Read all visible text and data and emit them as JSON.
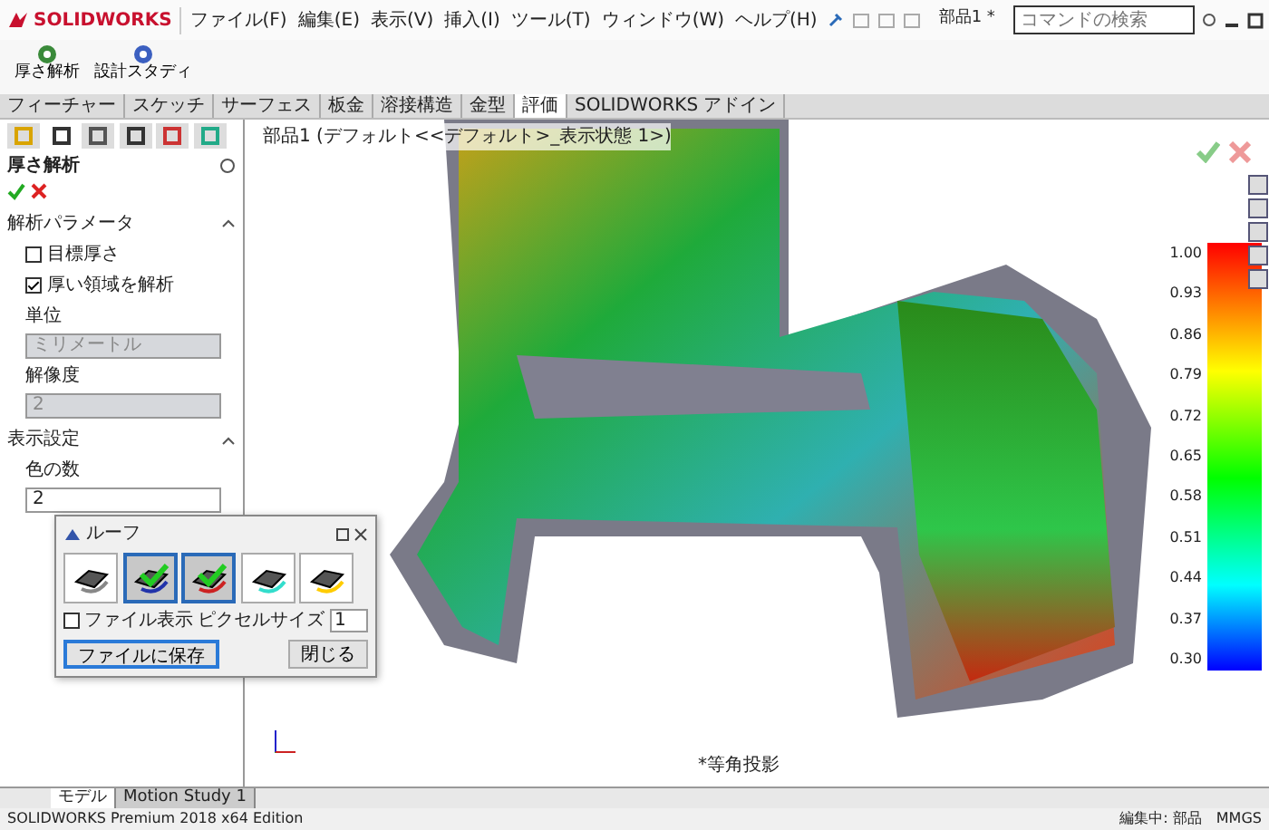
{
  "app": {
    "logo": "SOLIDWORKS",
    "menus": [
      "ファイル(F)",
      "編集(E)",
      "表示(V)",
      "挿入(I)",
      "ツール(T)",
      "ウィンドウ(W)",
      "ヘルプ(H)"
    ],
    "document_title": "部品1 *",
    "search": {
      "placeholder": "コマンドの検索"
    }
  },
  "ribbon": {
    "buttons": [
      {
        "label": "厚さ解析"
      },
      {
        "label": "設計スタディ"
      }
    ]
  },
  "command_tabs": [
    {
      "label": "フィーチャー",
      "selected": false
    },
    {
      "label": "スケッチ",
      "selected": false
    },
    {
      "label": "サーフェス",
      "selected": false
    },
    {
      "label": "板金",
      "selected": false
    },
    {
      "label": "溶接構造",
      "selected": false
    },
    {
      "label": "金型",
      "selected": false
    },
    {
      "label": "評価",
      "selected": true
    },
    {
      "label": "SOLIDWORKS アドイン",
      "selected": false
    }
  ],
  "panel_tabs": [
    {
      "selected": false
    },
    {
      "selected": true
    },
    {
      "selected": false
    },
    {
      "selected": false
    },
    {
      "selected": false
    },
    {
      "selected": false
    }
  ],
  "property_manager": {
    "title": "厚さ解析",
    "sections": [
      {
        "title": "解析パラメータ",
        "items": [
          {
            "kind": "checkbox",
            "label": "目標厚さ",
            "checked": false
          },
          {
            "kind": "checkbox",
            "label": "厚い領域を解析",
            "checked": true
          },
          {
            "kind": "label",
            "label": "単位"
          },
          {
            "kind": "spin",
            "value": "ミリメートル",
            "disabled": true
          },
          {
            "kind": "label",
            "label": "解像度"
          },
          {
            "kind": "spin",
            "value": "2",
            "disabled": true
          }
        ]
      },
      {
        "title": "表示設定",
        "items": [
          {
            "kind": "label",
            "label": "色の数"
          },
          {
            "kind": "spin",
            "value": "2",
            "disabled": false
          }
        ]
      }
    ]
  },
  "tree_path": "部品1 (デフォルト<<デフォルト>_表示状態 1>)",
  "legend": {
    "labels": [
      "1.00",
      "0.93",
      "0.86",
      "0.79",
      "0.72",
      "0.65",
      "0.58",
      "0.51",
      "0.44",
      "0.37",
      "0.30"
    ]
  },
  "dialog": {
    "title": "ルーフ",
    "tools": [
      {
        "selected": false
      },
      {
        "selected": true
      },
      {
        "selected": true
      },
      {
        "selected": false
      },
      {
        "selected": false
      }
    ],
    "checkbox": {
      "label": "ファイル表示",
      "checked": false
    },
    "pixel_label": "ピクセルサイズ",
    "pixel_value": "1",
    "buttons": [
      {
        "label": "ファイルに保存",
        "primary": true
      },
      {
        "label": "閉じる",
        "primary": false
      }
    ]
  },
  "view_label": "*等角投影",
  "bottom_tabs": [
    {
      "label": "モデル",
      "selected": true
    },
    {
      "label": "Motion Study 1",
      "selected": false
    }
  ],
  "status_bar": {
    "left": "SOLIDWORKS Premium 2018 x64 Edition",
    "right": [
      "編集中: 部品",
      "MMGS"
    ]
  }
}
